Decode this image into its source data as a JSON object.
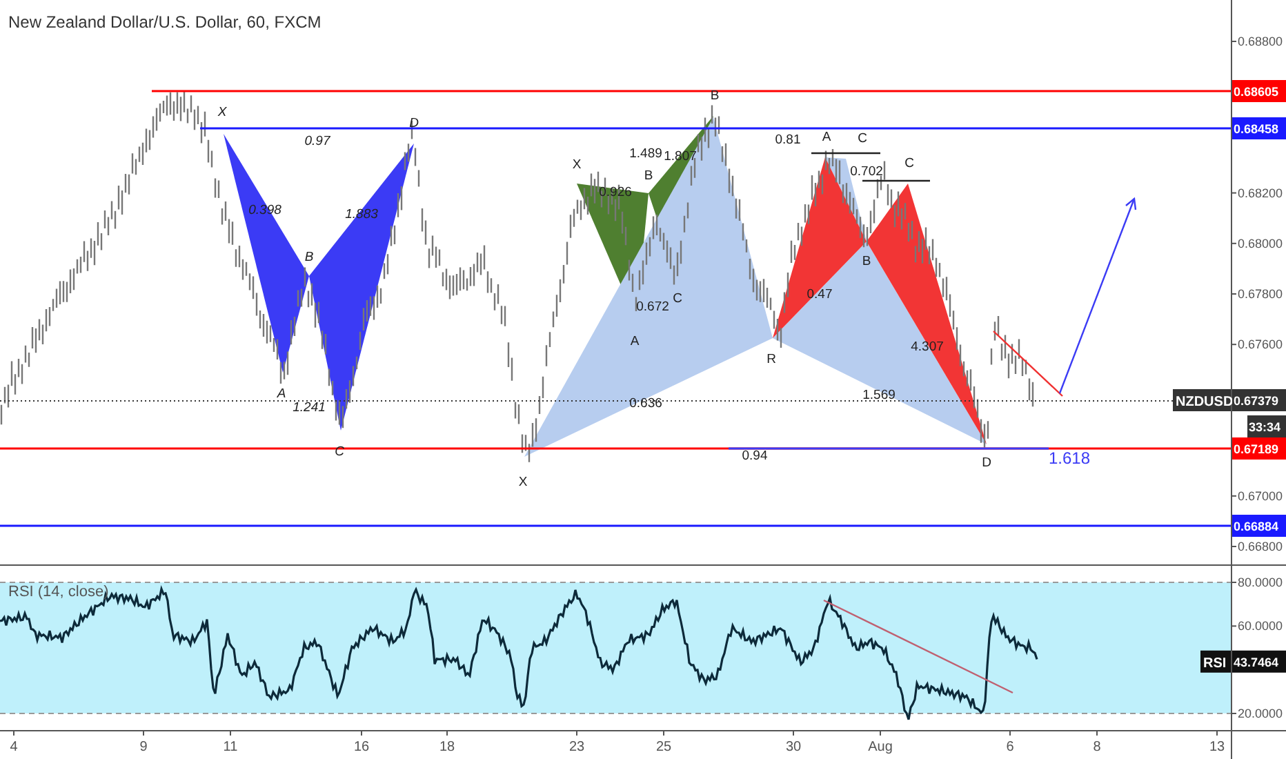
{
  "title": "New Zealand Dollar/U.S. Dollar, 60, FXCM",
  "price_axis": {
    "ticks": [
      "0.68800",
      "0.68200",
      "0.68000",
      "0.67800",
      "0.67600",
      "0.67000",
      "0.66800"
    ]
  },
  "levels": [
    {
      "label": "0.68605",
      "color": "#ff0000"
    },
    {
      "label": "0.68458",
      "color": "#1a1aff"
    },
    {
      "label": "0.67189",
      "color": "#ff0000"
    },
    {
      "label": "0.66884",
      "color": "#1a1aff"
    }
  ],
  "last_price": {
    "symbol": "NZDUSD",
    "label": "0.67379",
    "countdown": "33:34"
  },
  "patterns": [
    {
      "color": "#3b3bf5"
    },
    {
      "color": "#4f7f30"
    },
    {
      "color": "#b7cdef"
    },
    {
      "color": "#f23535"
    }
  ],
  "annotations": [
    "X",
    "0.97",
    "D",
    "0.398",
    "1.883",
    "B",
    "A",
    "1.241",
    "C",
    "X",
    "X",
    "0.926",
    "1.489",
    "B",
    "1.807",
    "B",
    "A",
    "0.672",
    "C",
    "0.636",
    "0.81",
    "A",
    "C",
    "0.702",
    "C",
    "0.47",
    "B",
    "R",
    "4.307",
    "1.569",
    "0.94",
    "D",
    "1.618"
  ],
  "rsi": {
    "title": "RSI (14, close)",
    "ticks": [
      "80.0000",
      "60.0000",
      "20.0000"
    ],
    "name": "RSI",
    "value": "43.7464"
  },
  "time_axis": [
    "4",
    "9",
    "11",
    "16",
    "18",
    "23",
    "25",
    "30",
    "Aug",
    "6",
    "8",
    "13"
  ]
}
